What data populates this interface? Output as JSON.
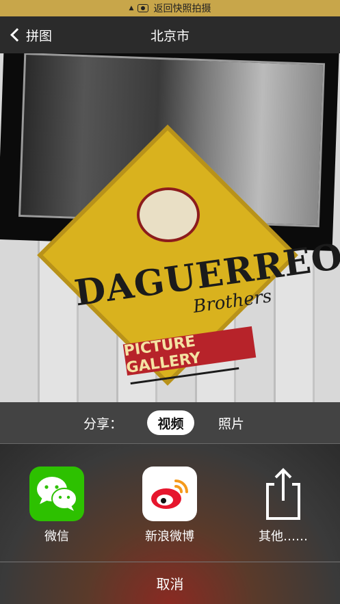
{
  "status_bar": {
    "text": "返回快照拍摄"
  },
  "nav": {
    "back_label": "拼图",
    "title": "北京市"
  },
  "photo": {
    "logo_title": "DAGUERREO",
    "logo_subtitle": "Brothers",
    "banner_text": "PICTURE GALLERY"
  },
  "share": {
    "label": "分享：",
    "tab_video": "视频",
    "tab_photo": "照片",
    "selected": "视频"
  },
  "apps": [
    {
      "label": "微信",
      "icon": "wechat-icon"
    },
    {
      "label": "新浪微博",
      "icon": "weibo-icon"
    },
    {
      "label": "其他……",
      "icon": "share-icon"
    }
  ],
  "cancel_label": "取消",
  "colors": {
    "status_bar": "#c8a64a",
    "wechat": "#2dc100",
    "weibo_red": "#e6162d",
    "pill_bg": "#ffffff"
  }
}
